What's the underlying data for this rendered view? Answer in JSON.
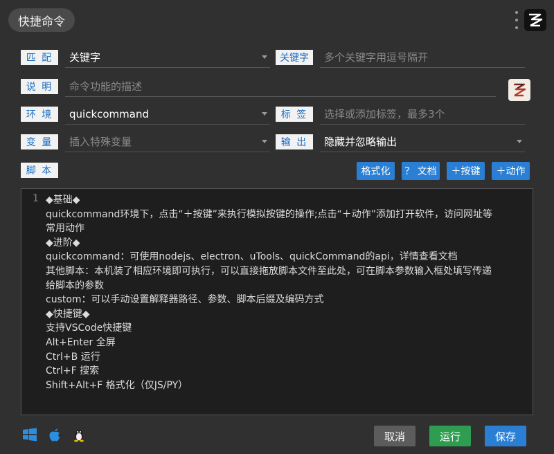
{
  "header": {
    "title": "快捷命令",
    "menu_icon": "more-vertical-icon",
    "logo_icon": "quickcommand-logo-icon"
  },
  "form": {
    "match": {
      "label": "匹 配",
      "value": "关键字"
    },
    "keyword": {
      "label": "关键字",
      "placeholder": "多个关键字用逗号隔开"
    },
    "description": {
      "label": "说 明",
      "placeholder": "命令功能的描述"
    },
    "environment": {
      "label": "环 境",
      "value": "quickcommand"
    },
    "tags": {
      "label": "标 签",
      "placeholder": "选择或添加标签，最多3个"
    },
    "variables": {
      "label": "变 量",
      "placeholder": "插入特殊变量"
    },
    "output": {
      "label": "输 出",
      "value": "隐藏并忽略输出"
    },
    "script": {
      "label": "脚 本"
    }
  },
  "script_toolbar": {
    "format": "格式化",
    "docs": "？ 文档",
    "add_key": "＋按键",
    "add_action": "＋动作"
  },
  "editor": {
    "line_number": "1",
    "lines": [
      "◆基础◆",
      "quickcommand环境下，点击“＋按键”来执行模拟按键的操作;点击“＋动作”添加打开软件，访问网址等",
      "常用动作",
      "◆进阶◆",
      "quickcommand：可使用nodejs、electron、uTools、quickCommand的api，详情查看文档",
      "其他脚本：本机装了相应环境即可执行，可以直接拖放脚本文件至此处，可在脚本参数输入框处填写传递",
      "给脚本的参数",
      "custom：可以手动设置解释器路径、参数、脚本后缀及编码方式",
      "◆快捷键◆",
      "支持VSCode快捷键",
      "Alt+Enter 全屏",
      "Ctrl+B 运行",
      "Ctrl+F 搜索",
      "Shift+Alt+F 格式化（仅JS/PY）"
    ]
  },
  "footer": {
    "platforms": [
      "windows-icon",
      "apple-icon",
      "linux-icon"
    ],
    "cancel": "取消",
    "run": "运行",
    "save": "保存"
  },
  "colors": {
    "background": "#303030",
    "accent_blue": "#2a7fd4",
    "run_green": "#2e9d4f",
    "cancel_gray": "#5c5c5c",
    "label_text": "#1b6ec2"
  }
}
